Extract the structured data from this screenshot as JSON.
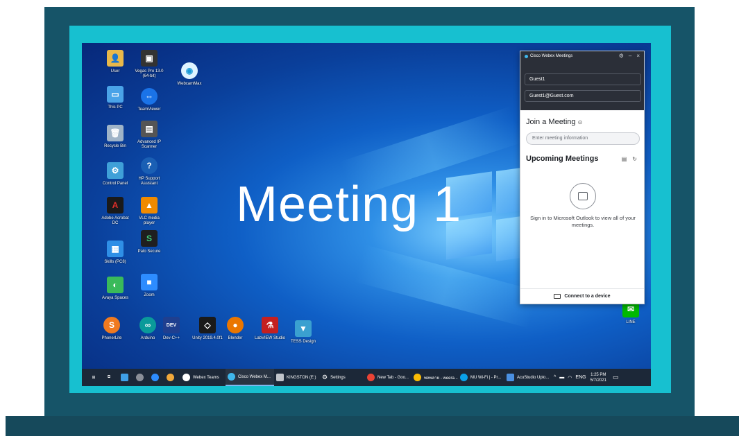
{
  "headline": "Meeting 1",
  "colors": {
    "bezel": "#17c0d0",
    "frame": "#165468",
    "taskbar": "#1c2838",
    "webex_dark": "#2b2f38"
  },
  "desktop_icons": [
    {
      "label": "User",
      "icon": "user-folder-icon",
      "color": "#e8b84a"
    },
    {
      "label": "This PC",
      "icon": "computer-icon",
      "color": "#4aa3e8"
    },
    {
      "label": "Recycle Bin",
      "icon": "recycle-bin-icon",
      "color": "#9fb4c8"
    },
    {
      "label": "Control Panel",
      "icon": "control-panel-icon",
      "color": "#3fa0d8"
    },
    {
      "label": "Adobe Acrobat DC",
      "icon": "acrobat-icon",
      "color": "#1a1a1a"
    },
    {
      "label": "Skills (PC8)",
      "icon": "tiles-icon",
      "color": "#2f8fe6"
    },
    {
      "label": "Avaya Spaces",
      "icon": "spaces-icon",
      "color": "#3aba5a"
    },
    {
      "label": "Vegas Pro 13.0 (64-bit)",
      "icon": "vegas-icon",
      "color": "#333333"
    },
    {
      "label": "TeamViewer",
      "icon": "teamviewer-icon",
      "color": "#1a73e8"
    },
    {
      "label": "Advanced IP Scanner",
      "icon": "scanner-icon",
      "color": "#555555"
    },
    {
      "label": "HP Support Assistant",
      "icon": "help-icon",
      "color": "#1a5fb4"
    },
    {
      "label": "VLC media player",
      "icon": "vlc-icon",
      "color": "#f08a00"
    },
    {
      "label": "Palo Secure",
      "icon": "palo-icon",
      "color": "#1f1f1f"
    },
    {
      "label": "Zoom",
      "icon": "zoom-icon",
      "color": "#2d8cff"
    },
    {
      "label": "WebcamMax",
      "icon": "webcam-icon",
      "color": "#ffffff"
    }
  ],
  "bottom_icons": [
    {
      "label": "PhonerLite",
      "icon": "sip-icon",
      "color": "#f07a20"
    },
    {
      "label": "Arduino",
      "icon": "arduino-icon",
      "color": "#0a9a9a"
    },
    {
      "label": "Dev-C++",
      "icon": "devcpp-icon",
      "color": "#1f3f8f"
    },
    {
      "label": "Unity 2019.4.0f1",
      "icon": "unity-icon",
      "color": "#1a1a1a"
    },
    {
      "label": "Blender",
      "icon": "blender-icon",
      "color": "#ea7600"
    },
    {
      "label": "LabVIEW Studio",
      "icon": "labview-icon",
      "color": "#c42020"
    },
    {
      "label": "TESS Design",
      "icon": "tess-icon",
      "color": "#3aa0d0"
    },
    {
      "label": "LINE",
      "icon": "line-icon",
      "color": "#00b900"
    }
  ],
  "webex": {
    "title": "Cisco Webex Meetings",
    "name_value": "Guest1",
    "email_value": "Guest1@Guest.com",
    "join_heading": "Join a Meeting",
    "join_placeholder": "Enter meeting information",
    "upcoming_heading": "Upcoming Meetings",
    "message": "Sign in to Microsoft Outlook to view all of your meetings.",
    "connect_label": "Connect to a device"
  },
  "taskbar": {
    "items": [
      {
        "label": "Webex Teams",
        "color": "#ffffff"
      },
      {
        "label": "Cisco Webex M...",
        "color": "#3fb6ea"
      },
      {
        "label": "KINGSTON (E:)",
        "color": "#c0c4ca"
      },
      {
        "label": "Settings",
        "color": "#ffffff"
      },
      {
        "label": "New Tab - Goo...",
        "color": "#ea4335"
      },
      {
        "label": "พลพลาย - weera...",
        "color": "#fbbc05"
      },
      {
        "label": "MU Wi-Fi | - Pr...",
        "color": "#0aa0e8"
      },
      {
        "label": "AcuStudio Uplo...",
        "color": "#4a90e2"
      }
    ],
    "language": "ENG",
    "time": "1:25 PM",
    "date": "5/7/2021"
  }
}
